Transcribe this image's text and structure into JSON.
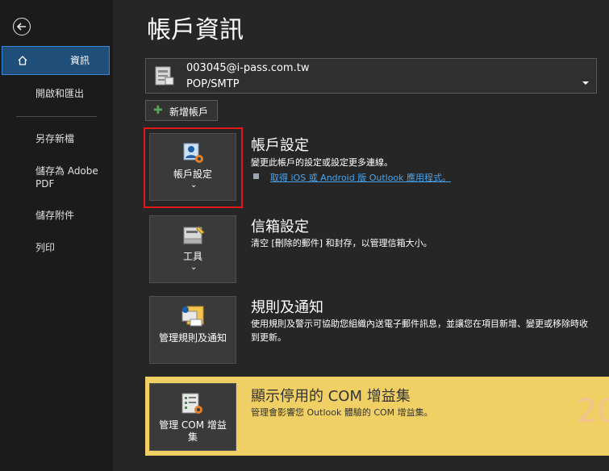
{
  "sidebar": {
    "items": [
      {
        "label": "資訊",
        "active": true
      },
      {
        "label": "開啟和匯出"
      },
      {
        "label": "另存新檔"
      },
      {
        "label": "儲存為 Adobe PDF"
      },
      {
        "label": "儲存附件"
      },
      {
        "label": "列印"
      }
    ]
  },
  "page": {
    "title": "帳戶資訊"
  },
  "account": {
    "email": "003045@i-pass.com.tw",
    "type": "POP/SMTP"
  },
  "add_account": {
    "label": "新增帳戶"
  },
  "sections": {
    "account_settings": {
      "tile_label": "帳戶設定",
      "title": "帳戶設定",
      "desc": "變更此帳戶的設定或設定更多連線。",
      "link": "取得 iOS 或 Android 版 Outlook 應用程式。"
    },
    "mailbox": {
      "tile_label": "工具",
      "title": "信箱設定",
      "desc": "清空 [刪除的郵件] 和封存，以管理信箱大小。"
    },
    "rules": {
      "tile_label": "管理規則及通知",
      "title": "規則及通知",
      "desc": "使用規則及警示可協助您組織內送電子郵件訊息，並讓您在項目新增、變更或移除時收到更新。"
    },
    "com": {
      "tile_label": "管理 COM 增益集",
      "title": "顯示停用的 COM 增益集",
      "desc": "管理會影響您 Outlook 體驗的 COM 增益集。"
    }
  },
  "watermark": {
    "text": "20"
  },
  "colors": {
    "accent": "#1f4e79",
    "highlight_band": "#f0d064",
    "link": "#4aa3ec",
    "red_frame": "#e01a1a"
  }
}
